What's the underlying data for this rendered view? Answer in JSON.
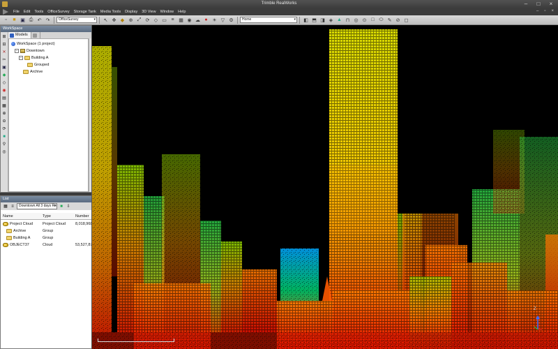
{
  "window": {
    "title": "Trimble RealWorks"
  },
  "menu": {
    "items": [
      "File",
      "Edit",
      "Tools",
      "OfficeSurvey",
      "Storage Tank",
      "Media Tools",
      "Display",
      "3D View",
      "Window",
      "Help"
    ]
  },
  "toolbar": {
    "module_select": "OfficeSurvey",
    "view_select": "Home"
  },
  "workspace": {
    "title": "WorkSpace",
    "tab_models": "Models",
    "tree": {
      "root": "WorkSpace (1 project)",
      "project": "Downtown",
      "building": "Building A",
      "grouped": "Grouped",
      "archive": "Archive"
    }
  },
  "list": {
    "title": "List",
    "select_value": "Downtown All 3 days Re",
    "columns": {
      "name": "Name",
      "type": "Type",
      "number": "Number"
    },
    "rows": [
      {
        "name": "Project Cloud",
        "type": "Project Cloud",
        "number": "8,018,968",
        "icon": "cloud-icon"
      },
      {
        "name": "Archive",
        "type": "Group",
        "number": "",
        "icon": "folder-icon"
      },
      {
        "name": "Building A",
        "type": "Group",
        "number": "",
        "icon": "folder-icon"
      },
      {
        "name": "OBJECT37",
        "type": "Cloud",
        "number": "53,527,87",
        "icon": "cloud-icon"
      }
    ]
  },
  "viewport": {
    "axis_label": "Z"
  },
  "colors": {
    "accent": "#5a6b80",
    "cloud_low": "#ff2a00",
    "cloud_mid": "#ffd000",
    "cloud_high": "#c8ff3a"
  }
}
